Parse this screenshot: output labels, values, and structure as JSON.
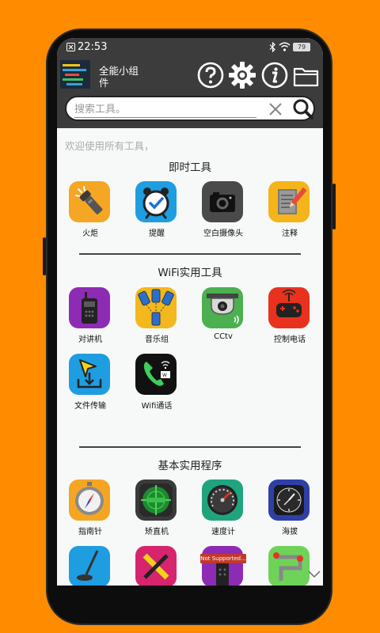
{
  "status_bar": {
    "time": "22:53",
    "battery": "79",
    "icons": [
      "notification-x-icon",
      "bluetooth-icon",
      "wifi-icon",
      "battery-icon"
    ]
  },
  "app_bar": {
    "title": "全能小组件",
    "buttons": [
      "help-icon",
      "settings-gear-icon",
      "info-icon",
      "folder-icon"
    ]
  },
  "search": {
    "placeholder": "搜索工具。",
    "value": ""
  },
  "welcome_text": "欢迎使用所有工具，",
  "sections": {
    "instant": {
      "title": "即时工具",
      "items": [
        "火炬",
        "提醒",
        "空白摄像头",
        "注释"
      ]
    },
    "wifi": {
      "title": "WiFi实用工具",
      "items": [
        "对讲机",
        "音乐组",
        "CCtv",
        "控制电话",
        "文件传输",
        "Wifi通话"
      ]
    },
    "basic": {
      "title": "基本实用程序",
      "items": [
        "指南针",
        "矫直机",
        "速度计",
        "海拔"
      ],
      "badge": "Not Supported..."
    }
  },
  "colors": {
    "background": "#FF8C00",
    "app_bar": "#3C3C3C",
    "torch": "#F5A623",
    "reminder": "#1E9DE0",
    "camera": "#4A4A4A",
    "notes": "#F4B41A",
    "walkie": "#8E2BB5",
    "music": "#F2B81E",
    "cctv": "#4CAF50",
    "control": "#E8321E",
    "file_transfer": "#1E9DE0",
    "wifi_call": "#111111",
    "compass": "#F4A623",
    "leveler": "#3A3A3A",
    "speedometer": "#1FA47E",
    "altitude": "#2E3FA6"
  }
}
